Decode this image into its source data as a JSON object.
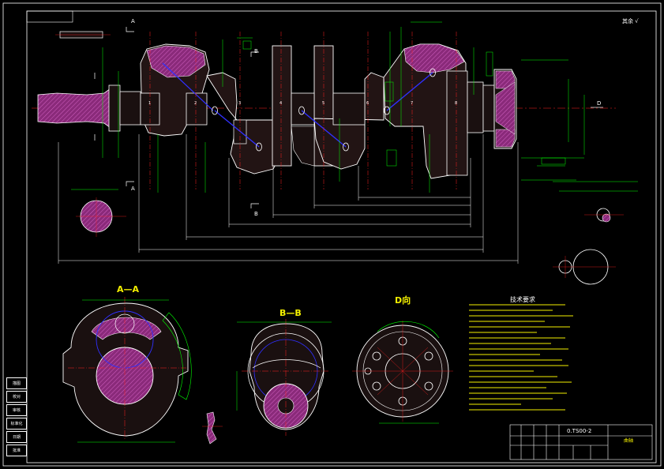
{
  "drawing": {
    "roughness_note": "其余 √",
    "section_aa_title": "A—A",
    "section_bb_title": "B—B",
    "view_d_title": "D向",
    "tech_req_title": "技术要求",
    "drawing_number": "0.TS00-2",
    "title_block_name": "曲轴",
    "section_marks": {
      "a_top": "A",
      "a_bottom": "A",
      "b_top": "B",
      "b_bottom": "B",
      "d": "D"
    },
    "journal_numbers": [
      "1",
      "2",
      "3",
      "4",
      "5",
      "6",
      "7",
      "8"
    ],
    "side_strip": [
      "描图",
      "校对",
      "审核",
      "标准化",
      "日期",
      "批准"
    ],
    "colors": {
      "background": "#000000",
      "outline": "#ffffff",
      "dimension": "#00ff00",
      "centerline": "#ff2020",
      "section_fill": "#a8348a",
      "hidden": "#3030ff",
      "text": "#f4f000",
      "body_fill": "#2a1a1a"
    }
  }
}
